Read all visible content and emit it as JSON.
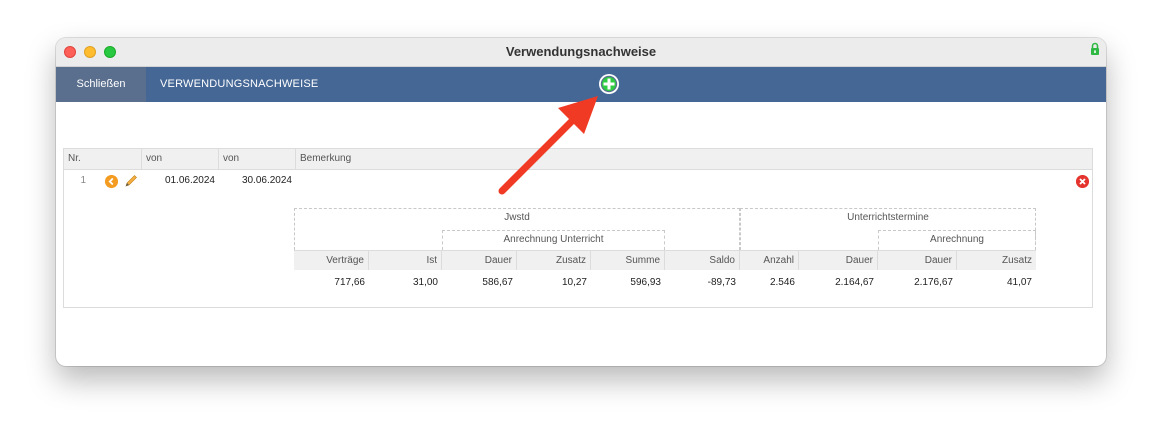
{
  "window": {
    "title": "Verwendungsnachweise"
  },
  "toolbar": {
    "close_label": "Schließen",
    "section_label": "VERWENDUNGSNACHWEISE"
  },
  "table": {
    "headers": {
      "nr": "Nr.",
      "von1": "von",
      "von2": "von",
      "bemerkung": "Bemerkung"
    },
    "rows": [
      {
        "nr": "1",
        "von": "01.06.2024",
        "bis": "30.06.2024",
        "bemerkung": ""
      }
    ]
  },
  "summary": {
    "group_jwstd": "Jwstd",
    "group_unterrichtstermine": "Unterrichtstermine",
    "group_anrechnung_unterricht": "Anrechnung Unterricht",
    "group_anrechnung": "Anrechnung",
    "columns": [
      "Verträge",
      "Ist",
      "Dauer",
      "Zusatz",
      "Summe",
      "Saldo",
      "Anzahl",
      "Dauer",
      "Dauer",
      "Zusatz"
    ],
    "values": [
      "717,66",
      "31,00",
      "586,67",
      "10,27",
      "596,93",
      "-89,73",
      "2.546",
      "2.164,67",
      "2.176,67",
      "41,07"
    ]
  },
  "colors": {
    "toolbar": "#456795",
    "close_button": "#5a6f8e",
    "arrow": "#f03a24",
    "add_icon": "#2ecc40"
  }
}
